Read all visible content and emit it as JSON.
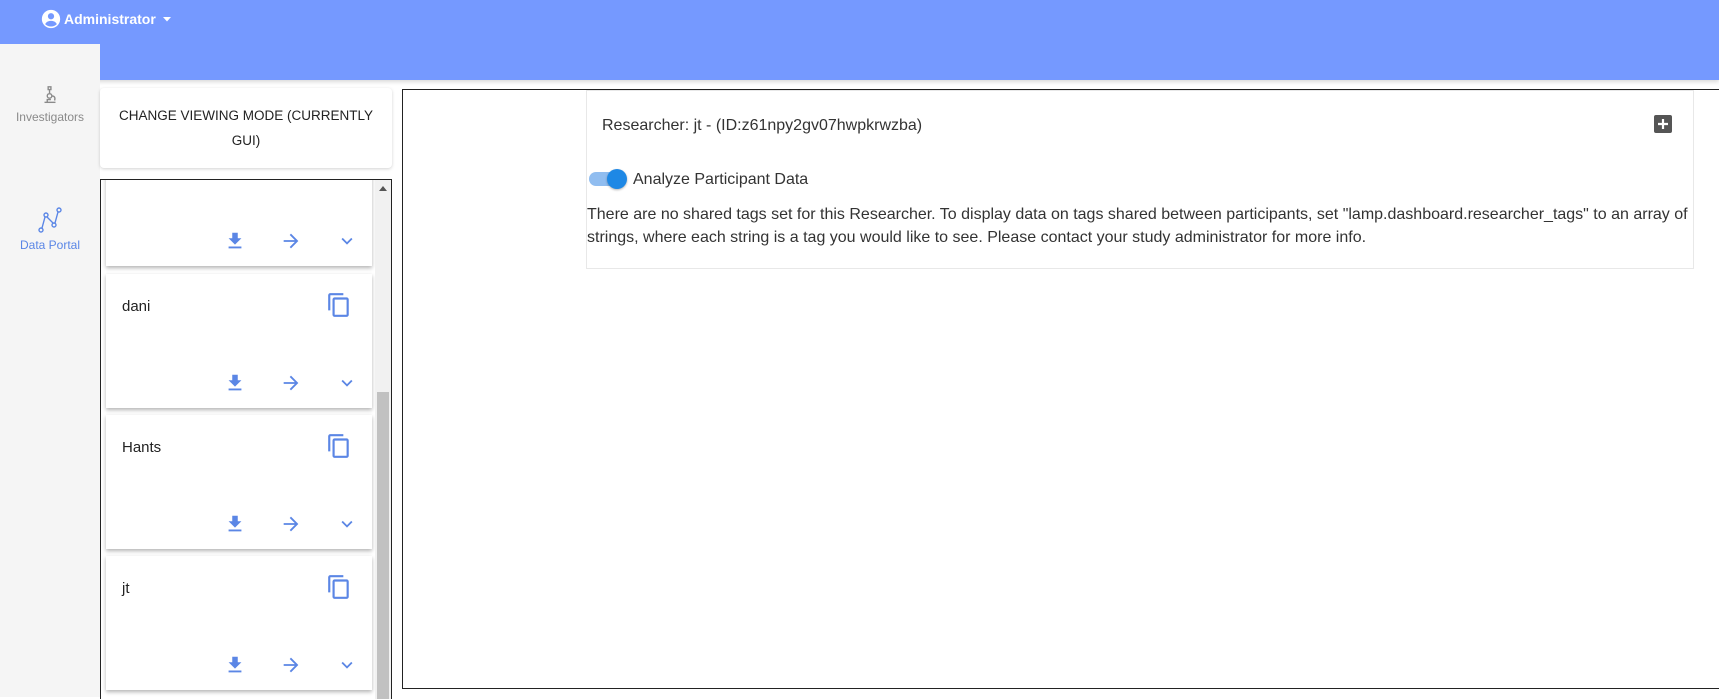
{
  "header": {
    "user_label": "Administrator",
    "icons": {
      "account": "account-circle-icon",
      "dropdown": "caret-down-icon"
    },
    "background_color": "#7599ff"
  },
  "nav": {
    "items": [
      {
        "label": "Investigators",
        "icon": "microscope-icon",
        "active": false
      },
      {
        "label": "Data Portal",
        "icon": "chart-line-icon",
        "active": true
      }
    ]
  },
  "viewing_mode": {
    "label": "CHANGE VIEWING MODE (CURRENTLY GUI)"
  },
  "researcher_list": {
    "items": [
      {
        "name": ""
      },
      {
        "name": "dani"
      },
      {
        "name": "Hants"
      },
      {
        "name": "jt"
      }
    ],
    "icons": {
      "copy": "copy-icon",
      "download": "download-icon",
      "open": "arrow-right-icon",
      "expand": "chevron-down-icon"
    },
    "accent_color": "#5b86e5"
  },
  "main": {
    "researcher_title": "Researcher: jt - (ID:z61npy2gv07hwpkrwzba)",
    "add_icon": "plus-box-icon",
    "toggle_label": "Analyze Participant Data",
    "toggle_on": true,
    "info_text": "There are no shared tags set for this Researcher. To display data on tags shared between participants, set \"lamp.dashboard.researcher_tags\" to an array of strings, where each string is a tag you would like to see. Please contact your study administrator for more info."
  }
}
